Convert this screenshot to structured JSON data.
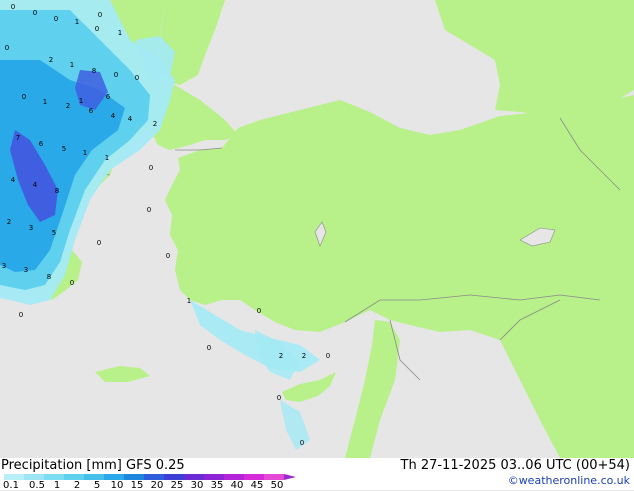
{
  "map": {
    "colors": {
      "sea": "#e6e6e6",
      "land": "#b8f08a",
      "border": "#8a8a8a",
      "precip_light": "#a3eaf5",
      "precip_mid": "#5fd0ee",
      "precip_heavy": "#2aa9e8",
      "precip_max": "#3f5fe0"
    },
    "precip_values": [
      "0",
      "0",
      "0",
      "0",
      "1",
      "1",
      "0",
      "0",
      "2",
      "1",
      "8",
      "0",
      "1",
      "0",
      "2",
      "4",
      "6",
      "4",
      "6",
      "2",
      "7",
      "6",
      "5",
      "1",
      "1",
      "0",
      "4",
      "4",
      "8",
      "0",
      "2",
      "3",
      "5",
      "0",
      "0",
      "3",
      "3",
      "8",
      "0",
      "0",
      "1",
      "0",
      "0",
      "2",
      "2",
      "0",
      "0",
      "0",
      "1",
      "0"
    ]
  },
  "footer": {
    "product": "Precipitation [mm]  GFS 0.25",
    "run": "Th 27-11-2025 03..06 UTC (00+54)",
    "credit": "©weatheronline.co.uk",
    "scale_labels": [
      "0.1",
      "0.5",
      "1",
      "2",
      "5",
      "10",
      "15",
      "20",
      "25",
      "30",
      "35",
      "40",
      "45",
      "50"
    ],
    "scale_colors": [
      "#b7eef7",
      "#9be5f4",
      "#7cdcf1",
      "#5fd0ee",
      "#45c0ea",
      "#2aa9e8",
      "#1f86e0",
      "#2f5ddc",
      "#3c3fd6",
      "#6a2bd4",
      "#8d25d6",
      "#b424d8",
      "#d52bd9",
      "#e44ad6"
    ],
    "arrow_color": "#9b2bd1"
  }
}
